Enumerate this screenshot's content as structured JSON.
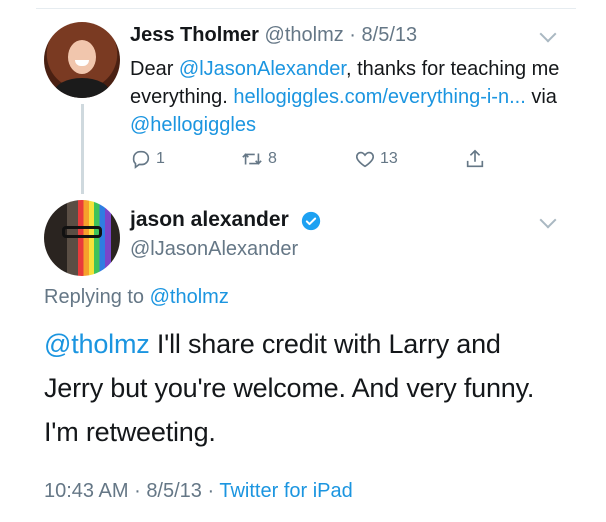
{
  "tweet1": {
    "name": "Jess Tholmer",
    "handle": "@tholmz",
    "sep": "·",
    "date": "8/5/13",
    "body_prefix": "Dear ",
    "mention": "@lJasonAlexander",
    "body_mid": ", thanks for teaching me everything. ",
    "link": "hellogiggles.com/everything-i-n...",
    "body_via": " via ",
    "via_handle": "@hellogiggles",
    "replies": "1",
    "retweets": "8",
    "likes": "13",
    "icons": [
      "reply-icon",
      "retweet-icon",
      "like-icon",
      "share-icon",
      "chevron-down-icon"
    ]
  },
  "tweet2": {
    "name": "jason alexander",
    "handle": "@lJasonAlexander",
    "replying_label": "Replying to ",
    "replying_handle": "@tholmz",
    "body_mention": "@tholmz",
    "body_text": " I'll share credit with Larry and Jerry but you're welcome. And very funny. I'm retweeting.",
    "time": "10:43 AM",
    "sep": "·",
    "date": "8/5/13",
    "source": "Twitter for iPad",
    "icons": [
      "verified-badge-icon",
      "chevron-down-icon"
    ]
  },
  "colors": {
    "link": "#1b95e0",
    "muted": "#657786",
    "text": "#14171a",
    "verified": "#1da1f2"
  }
}
